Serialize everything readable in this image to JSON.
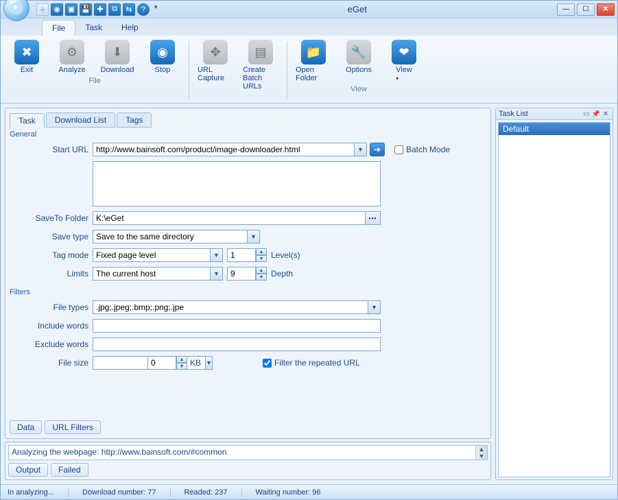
{
  "app": {
    "title": "eGet"
  },
  "menubar": {
    "file": "File",
    "task": "Task",
    "help": "Help"
  },
  "ribbon": {
    "groups": {
      "file": "File",
      "view": "View"
    },
    "exit": "Exit",
    "analyze": "Analyze",
    "download": "Download",
    "stop": "Stop",
    "url_capture": "URL Capture",
    "create_batch": "Create Batch URLs",
    "open_folder": "Open Folder",
    "options": "Options",
    "view": "View"
  },
  "tabs": {
    "task": "Task",
    "download_list": "Download List",
    "tags": "Tags"
  },
  "sections": {
    "general": "General",
    "filters": "Filters"
  },
  "labels": {
    "start_url": "Start URL",
    "batch_mode": "Batch Mode",
    "saveto_folder": "SaveTo Folder",
    "save_type": "Save type",
    "tag_mode": "Tag mode",
    "levels": "Level(s)",
    "limits": "Limits",
    "depth": "Depth",
    "file_types": "File types",
    "include_words": "Include words",
    "exclude_words": "Exclude words",
    "file_size": "File size",
    "kb": "KB",
    "filter_repeated": "Filter the repeated URL"
  },
  "values": {
    "start_url": "http://www.bainsoft.com/product/image-downloader.html",
    "urls_extra": "",
    "saveto_folder": "K:\\eGet",
    "save_type": "Save to the same directory",
    "tag_mode": "Fixed page level",
    "levels": "1",
    "limits": "The current host",
    "depth": "9",
    "file_types": ".jpg;.jpeg;.bmp;.png;.jpe",
    "include_words": "",
    "exclude_words": "",
    "file_size_op": "",
    "file_size_val": "0",
    "filter_repeated_checked": true,
    "batch_mode_checked": false
  },
  "bottom_buttons": {
    "data": "Data",
    "url_filters": "URL Filters"
  },
  "log": {
    "text": "Analyzing the webpage: http://www.bainsoft.com/#common",
    "tabs": {
      "output": "Output",
      "failed": "Failed"
    }
  },
  "task_list": {
    "title": "Task List",
    "items": [
      "Default"
    ]
  },
  "statusbar": {
    "state": "In analyzing...",
    "download_number": "Download number: 77",
    "readed": "Readed: 237",
    "waiting": "Waiting number: 96"
  }
}
